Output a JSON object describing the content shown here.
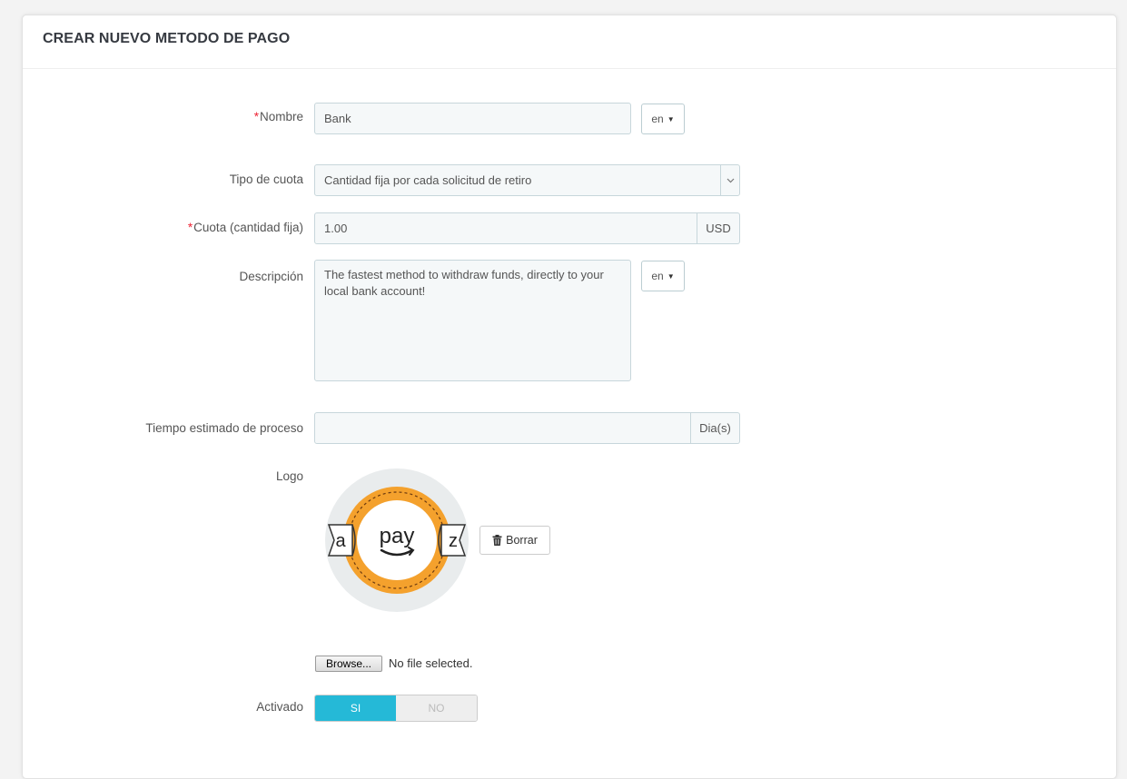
{
  "panel": {
    "title": "CREAR NUEVO METODO DE PAGO"
  },
  "form": {
    "name": {
      "required_mark": "*",
      "label": "Nombre",
      "value": "Bank",
      "lang": "en"
    },
    "fee_type": {
      "label": "Tipo de cuota",
      "value": "Cantidad fija por cada solicitud de retiro"
    },
    "fee_amount": {
      "required_mark": "*",
      "label": "Cuota (cantidad fija)",
      "value": "1.00",
      "unit": "USD"
    },
    "description": {
      "label": "Descripción",
      "value": "The fastest method to withdraw funds, directly to your local bank account!",
      "lang": "en"
    },
    "processing_time": {
      "label": "Tiempo estimado de proceso",
      "value": "",
      "unit": "Dia(s)"
    },
    "logo": {
      "label": "Logo",
      "logo_text": {
        "left": "a",
        "center": "pay",
        "right": "z"
      },
      "delete_label": "Borrar",
      "browse_label": "Browse...",
      "file_status": "No file selected."
    },
    "active": {
      "label": "Activado",
      "yes": "SI",
      "no": "NO",
      "selected": "SI"
    }
  },
  "colors": {
    "accent": "#25b9d7",
    "required": "#e23",
    "logo_orange": "#f4a12d"
  },
  "icons": {
    "caret": "caret-down-icon",
    "select": "chevron-down-icon",
    "delete": "trash-icon"
  }
}
